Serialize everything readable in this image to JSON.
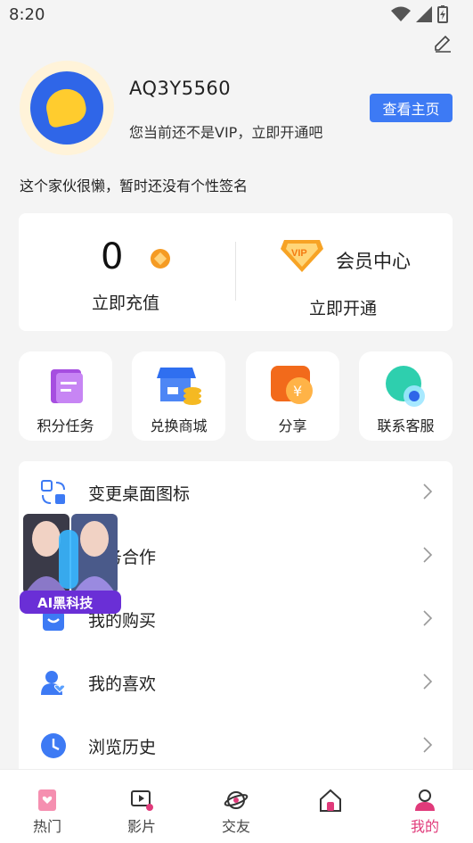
{
  "status_bar": {
    "time": "8:20"
  },
  "profile": {
    "username": "AQ3Y5560",
    "vip_status": "您当前还不是VIP，立即开通吧",
    "view_homepage": "查看主页",
    "signature": "这个家伙很懒，暂时还没有个性签名"
  },
  "wallet": {
    "coins": "0",
    "recharge": "立即充值",
    "member_center": "会员中心",
    "open_now": "立即开通",
    "vip_badge_text": "VIP"
  },
  "quick_actions": [
    {
      "label": "积分任务",
      "icon": "points-task-icon"
    },
    {
      "label": "兑换商城",
      "icon": "exchange-mall-icon"
    },
    {
      "label": "分享",
      "icon": "share-icon"
    },
    {
      "label": "联系客服",
      "icon": "customer-service-icon"
    }
  ],
  "menu": [
    {
      "label": "变更桌面图标",
      "icon": "change-icon-icon"
    },
    {
      "label": "商务合作",
      "icon": "business-icon"
    },
    {
      "label": "我的购买",
      "icon": "purchase-icon"
    },
    {
      "label": "我的喜欢",
      "icon": "favorite-user-icon"
    },
    {
      "label": "浏览历史",
      "icon": "clock-icon"
    }
  ],
  "ad": {
    "text": "AI黑科技"
  },
  "tabbar": [
    {
      "label": "热门",
      "active": false
    },
    {
      "label": "影片",
      "active": false
    },
    {
      "label": "交友",
      "active": false
    },
    {
      "label": "",
      "active": false
    },
    {
      "label": "我的",
      "active": true
    }
  ],
  "colors": {
    "accent": "#3d7af4",
    "tab_active": "#e03a7a"
  }
}
